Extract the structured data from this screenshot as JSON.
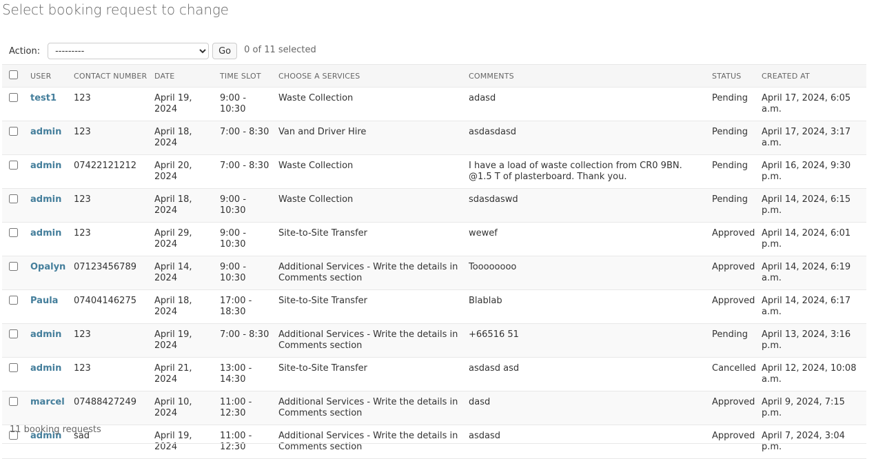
{
  "page_title": "Select booking request to change",
  "actions": {
    "label": "Action:",
    "select_value": "---------",
    "go_label": "Go",
    "counter": "0 of 11 selected"
  },
  "columns": [
    "USER",
    "CONTACT NUMBER",
    "DATE",
    "TIME SLOT",
    "CHOOSE A SERVICES",
    "COMMENTS",
    "STATUS",
    "CREATED AT"
  ],
  "rows": [
    {
      "user": "test1",
      "contact": "123",
      "date": "April 19, 2024",
      "slot": "9:00 - 10:30",
      "service": "Waste Collection",
      "comments": "adasd",
      "status": "Pending",
      "created": "April 17, 2024, 6:05 a.m."
    },
    {
      "user": "admin",
      "contact": "123",
      "date": "April 18, 2024",
      "slot": "7:00 - 8:30",
      "service": "Van and Driver Hire",
      "comments": "asdasdasd",
      "status": "Pending",
      "created": "April 17, 2024, 3:17 a.m."
    },
    {
      "user": "admin",
      "contact": "07422121212",
      "date": "April 20, 2024",
      "slot": "7:00 - 8:30",
      "service": "Waste Collection",
      "comments": "I have a load of waste collection from CR0 9BN. @1.5 T of plasterboard. Thank you.",
      "status": "Pending",
      "created": "April 16, 2024, 9:30 p.m."
    },
    {
      "user": "admin",
      "contact": "123",
      "date": "April 18, 2024",
      "slot": "9:00 - 10:30",
      "service": "Waste Collection",
      "comments": "sdasdaswd",
      "status": "Pending",
      "created": "April 14, 2024, 6:15 p.m."
    },
    {
      "user": "admin",
      "contact": "123",
      "date": "April 29, 2024",
      "slot": "9:00 - 10:30",
      "service": "Site-to-Site Transfer",
      "comments": "wewef",
      "status": "Approved",
      "created": "April 14, 2024, 6:01 p.m."
    },
    {
      "user": "Opalyn",
      "contact": "07123456789",
      "date": "April 14, 2024",
      "slot": "9:00 - 10:30",
      "service": "Additional Services - Write the details in Comments section",
      "comments": "Toooooooo",
      "status": "Approved",
      "created": "April 14, 2024, 6:19 a.m."
    },
    {
      "user": "Paula",
      "contact": "07404146275",
      "date": "April 18, 2024",
      "slot": "17:00 - 18:30",
      "service": "Site-to-Site Transfer",
      "comments": "Blablab",
      "status": "Approved",
      "created": "April 14, 2024, 6:17 a.m."
    },
    {
      "user": "admin",
      "contact": "123",
      "date": "April 19, 2024",
      "slot": "7:00 - 8:30",
      "service": "Additional Services - Write the details in Comments section",
      "comments": "+66516 51",
      "status": "Pending",
      "created": "April 13, 2024, 3:16 p.m."
    },
    {
      "user": "admin",
      "contact": "123",
      "date": "April 21, 2024",
      "slot": "13:00 - 14:30",
      "service": "Site-to-Site Transfer",
      "comments": "asdasd asd",
      "status": "Cancelled",
      "created": "April 12, 2024, 10:08 a.m."
    },
    {
      "user": "marcel",
      "contact": "07488427249",
      "date": "April 10, 2024",
      "slot": "11:00 - 12:30",
      "service": "Additional Services - Write the details in Comments section",
      "comments": "dasd",
      "status": "Approved",
      "created": "April 9, 2024, 7:15 p.m."
    },
    {
      "user": "admin",
      "contact": "sad",
      "date": "April 19, 2024",
      "slot": "11:00 - 12:30",
      "service": "Additional Services - Write the details in Comments section",
      "comments": "asdasd",
      "status": "Approved",
      "created": "April 7, 2024, 3:04 p.m."
    }
  ],
  "footer_count": "11 booking requests"
}
